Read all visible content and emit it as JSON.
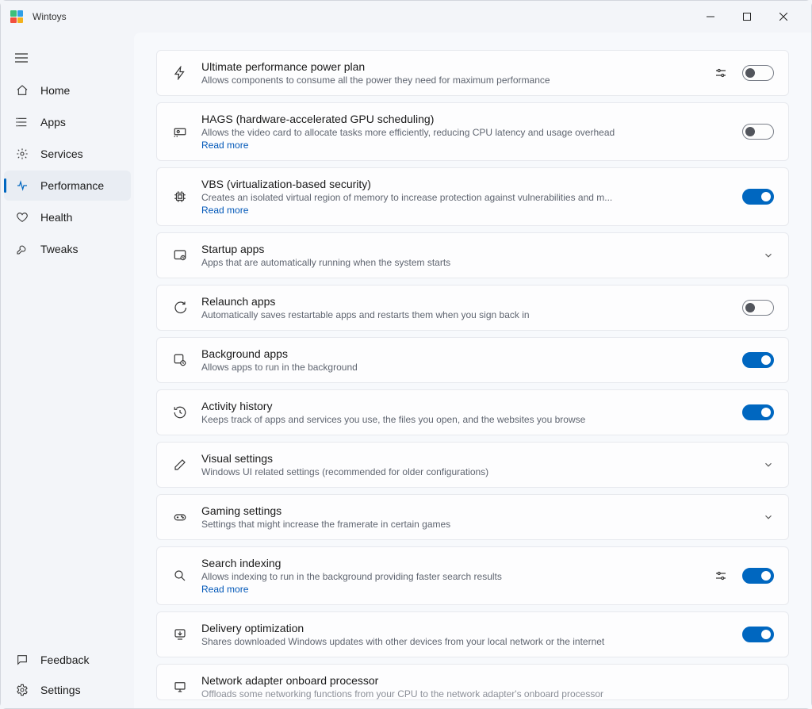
{
  "app": {
    "title": "Wintoys"
  },
  "sidebar": {
    "items": [
      {
        "label": "Home"
      },
      {
        "label": "Apps"
      },
      {
        "label": "Services"
      },
      {
        "label": "Performance"
      },
      {
        "label": "Health"
      },
      {
        "label": "Tweaks"
      }
    ],
    "bottom": [
      {
        "label": "Feedback"
      },
      {
        "label": "Settings"
      }
    ]
  },
  "cards": {
    "ultimate": {
      "title": "Ultimate performance power plan",
      "desc": "Allows components to consume all the power they need for maximum performance"
    },
    "hags": {
      "title": "HAGS (hardware-accelerated GPU scheduling)",
      "desc": "Allows the video card to allocate tasks more efficiently, reducing CPU latency and usage overhead",
      "read": "Read more"
    },
    "vbs": {
      "title": "VBS (virtualization-based security)",
      "desc": "Creates an isolated virtual region of memory to increase protection against vulnerabilities and m...",
      "read": "Read more"
    },
    "startup": {
      "title": "Startup apps",
      "desc": "Apps that are automatically running when the system starts"
    },
    "relaunch": {
      "title": "Relaunch apps",
      "desc": "Automatically saves restartable apps and restarts them when you sign back in"
    },
    "background": {
      "title": "Background apps",
      "desc": "Allows apps to run in the background"
    },
    "activity": {
      "title": "Activity history",
      "desc": "Keeps track of apps and services you use, the files you open, and the websites you browse"
    },
    "visual": {
      "title": "Visual settings",
      "desc": "Windows UI related settings (recommended for older configurations)"
    },
    "gaming": {
      "title": "Gaming settings",
      "desc": "Settings that might increase the framerate in certain games"
    },
    "search": {
      "title": "Search indexing",
      "desc": "Allows indexing to run in the background providing faster search results",
      "read": "Read more"
    },
    "delivery": {
      "title": "Delivery optimization",
      "desc": "Shares downloaded Windows updates with other devices from your local network or the internet"
    },
    "network": {
      "title": "Network adapter onboard processor",
      "desc": "Offloads some networking functions from your CPU to the network adapter's onboard processor"
    }
  }
}
